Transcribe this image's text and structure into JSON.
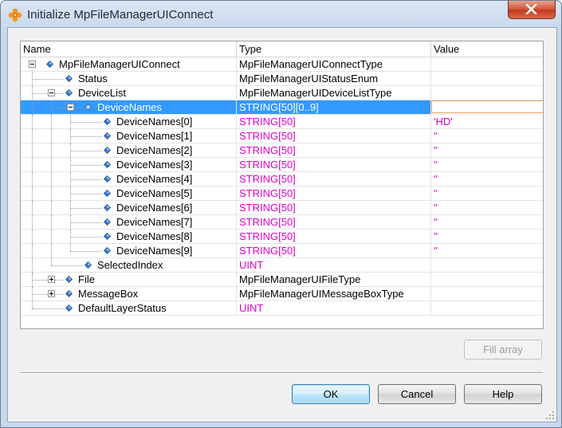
{
  "window": {
    "title": "Initialize MpFileManagerUIConnect"
  },
  "grid": {
    "columns": {
      "name": "Name",
      "type": "Type",
      "value": "Value"
    },
    "rows": [
      {
        "name": "MpFileManagerUIConnect",
        "type": "MpFileManagerUIConnectType",
        "value": "",
        "level": 0,
        "expander": "minus",
        "type_style": "normal"
      },
      {
        "name": "Status",
        "type": "MpFileManagerUIStatusEnum",
        "value": "",
        "level": 1,
        "expander": "none",
        "type_style": "normal"
      },
      {
        "name": "DeviceList",
        "type": "MpFileManagerUIDeviceListType",
        "value": "",
        "level": 1,
        "expander": "minus",
        "type_style": "normal"
      },
      {
        "name": "DeviceNames",
        "type": "STRING[50][0..9]",
        "value": "",
        "level": 2,
        "expander": "minus",
        "type_style": "normal",
        "selected": true
      },
      {
        "name": "DeviceNames[0]",
        "type": "STRING[50]",
        "value": "'HD'",
        "level": 3,
        "expander": "none",
        "type_style": "edit"
      },
      {
        "name": "DeviceNames[1]",
        "type": "STRING[50]",
        "value": "''",
        "level": 3,
        "expander": "none",
        "type_style": "edit"
      },
      {
        "name": "DeviceNames[2]",
        "type": "STRING[50]",
        "value": "''",
        "level": 3,
        "expander": "none",
        "type_style": "edit"
      },
      {
        "name": "DeviceNames[3]",
        "type": "STRING[50]",
        "value": "''",
        "level": 3,
        "expander": "none",
        "type_style": "edit"
      },
      {
        "name": "DeviceNames[4]",
        "type": "STRING[50]",
        "value": "''",
        "level": 3,
        "expander": "none",
        "type_style": "edit"
      },
      {
        "name": "DeviceNames[5]",
        "type": "STRING[50]",
        "value": "''",
        "level": 3,
        "expander": "none",
        "type_style": "edit"
      },
      {
        "name": "DeviceNames[6]",
        "type": "STRING[50]",
        "value": "''",
        "level": 3,
        "expander": "none",
        "type_style": "edit"
      },
      {
        "name": "DeviceNames[7]",
        "type": "STRING[50]",
        "value": "''",
        "level": 3,
        "expander": "none",
        "type_style": "edit"
      },
      {
        "name": "DeviceNames[8]",
        "type": "STRING[50]",
        "value": "''",
        "level": 3,
        "expander": "none",
        "type_style": "edit"
      },
      {
        "name": "DeviceNames[9]",
        "type": "STRING[50]",
        "value": "''",
        "level": 3,
        "expander": "none",
        "type_style": "edit"
      },
      {
        "name": "SelectedIndex",
        "type": "UINT",
        "value": "",
        "level": 2,
        "expander": "none",
        "type_style": "edit"
      },
      {
        "name": "File",
        "type": "MpFileManagerUIFileType",
        "value": "",
        "level": 1,
        "expander": "plus",
        "type_style": "normal"
      },
      {
        "name": "MessageBox",
        "type": "MpFileManagerUIMessageBoxType",
        "value": "",
        "level": 1,
        "expander": "plus",
        "type_style": "normal"
      },
      {
        "name": "DefaultLayerStatus",
        "type": "UINT",
        "value": "",
        "level": 1,
        "expander": "none",
        "type_style": "edit"
      }
    ]
  },
  "buttons": {
    "fill_array": "Fill array",
    "ok": "OK",
    "cancel": "Cancel",
    "help": "Help"
  },
  "colors": {
    "selection": "#3399ff",
    "editable_type": "#e000c8",
    "diamond": "#3b78c9"
  },
  "icons": {
    "app": "puzzle-flower-icon",
    "close": "close-icon",
    "node": "diamond-icon",
    "expand": "plus-box-icon",
    "collapse": "minus-box-icon"
  }
}
